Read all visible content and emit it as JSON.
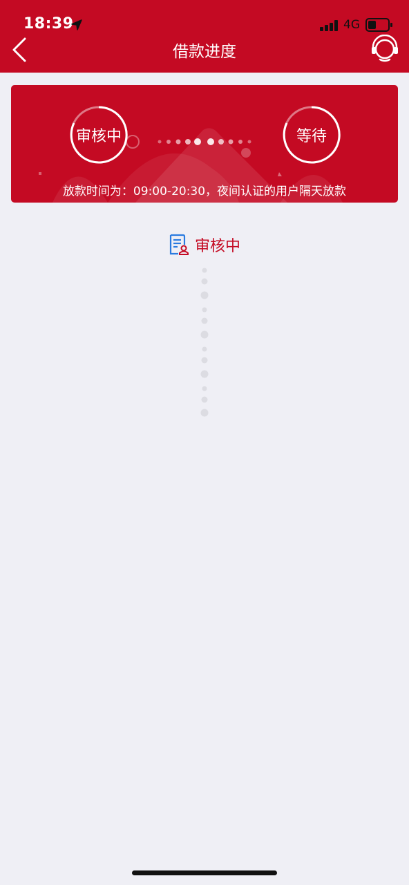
{
  "status_bar": {
    "time": "18:39",
    "network": "4G"
  },
  "nav": {
    "title": "借款进度"
  },
  "progress_card": {
    "step1_label": "审核中",
    "step2_label": "等待",
    "notice": "放款时间为：09:00-20:30，夜间认证的用户隔天放款"
  },
  "current_status": {
    "label": "审核中"
  },
  "colors": {
    "brand_red": "#c40a23",
    "icon_blue": "#2a7be0",
    "background": "#efeff5"
  }
}
